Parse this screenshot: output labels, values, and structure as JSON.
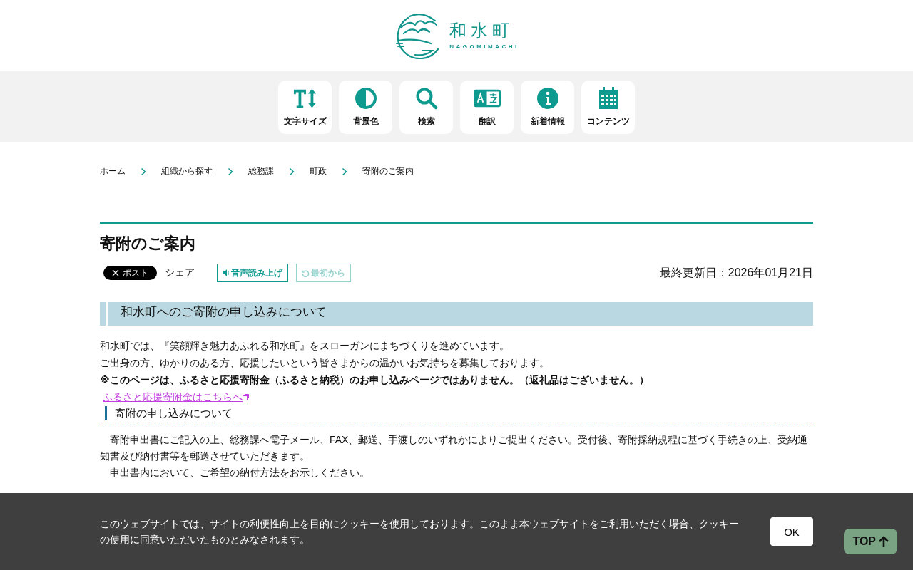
{
  "logo": {
    "name": "和水町",
    "romaji": "NAGOMIMACHI"
  },
  "toolbar": [
    {
      "kind": "textsize",
      "label": "文字サイズ"
    },
    {
      "kind": "contrast",
      "label": "背景色"
    },
    {
      "kind": "search",
      "label": "検索"
    },
    {
      "kind": "translate",
      "label": "翻訳"
    },
    {
      "kind": "info",
      "label": "新着情報"
    },
    {
      "kind": "calendar",
      "label": "コンテンツ"
    }
  ],
  "breadcrumb": [
    {
      "label": "ホーム",
      "link": true
    },
    {
      "label": "組織から探す",
      "link": true
    },
    {
      "label": "総務課",
      "link": true
    },
    {
      "label": "町政",
      "link": true
    },
    {
      "label": "寄附のご案内",
      "link": false
    }
  ],
  "page_title": "寄附のご案内",
  "share": {
    "post_button": "ポスト",
    "share_label": "シェア"
  },
  "speech_buttons": [
    {
      "label": "音声読み上げ",
      "disabled": false
    },
    {
      "label": "最初から",
      "disabled": true
    }
  ],
  "last_updated": "最終更新日：2026年01月21日",
  "section_heading": "和水町へのご寄附の申し込みについて",
  "intro": [
    "和水町では、『笑顔輝き魅力あふれる和水町』をスローガンにまちづくりを進めています。",
    "ご出身の方、ゆかりのある方、応援したいという皆さまからの温かいお気持ちを募集しております。"
  ],
  "notice": "※このページは、ふるさと応援寄附金（ふるさと納税）のお申し込みページではありません。（返礼品はございません。）",
  "external_link": "ふるさと応援寄附金はこちらへ",
  "subsections": [
    {
      "heading": "寄附の申し込みについて",
      "paragraphs": [
        "寄附申出書にご記入の上、総務課へ電子メール、FAX、郵送、手渡しのいずれかによりご提出ください。受付後、寄附採納規程に基づく手続きの上、受納通知書及び納付書等を郵送させていただきます。",
        "申出書内において、ご希望の納付方法をお示しください。"
      ]
    }
  ],
  "cookie_banner": {
    "text": "このウェブサイトでは、サイトの利便性向上を目的にクッキーを使用しております。このまま本ウェブサイトをご利用いただく場合、クッキーの使用に同意いただいたものとみなされます。",
    "button": "OK"
  },
  "top_button": "TOP"
}
